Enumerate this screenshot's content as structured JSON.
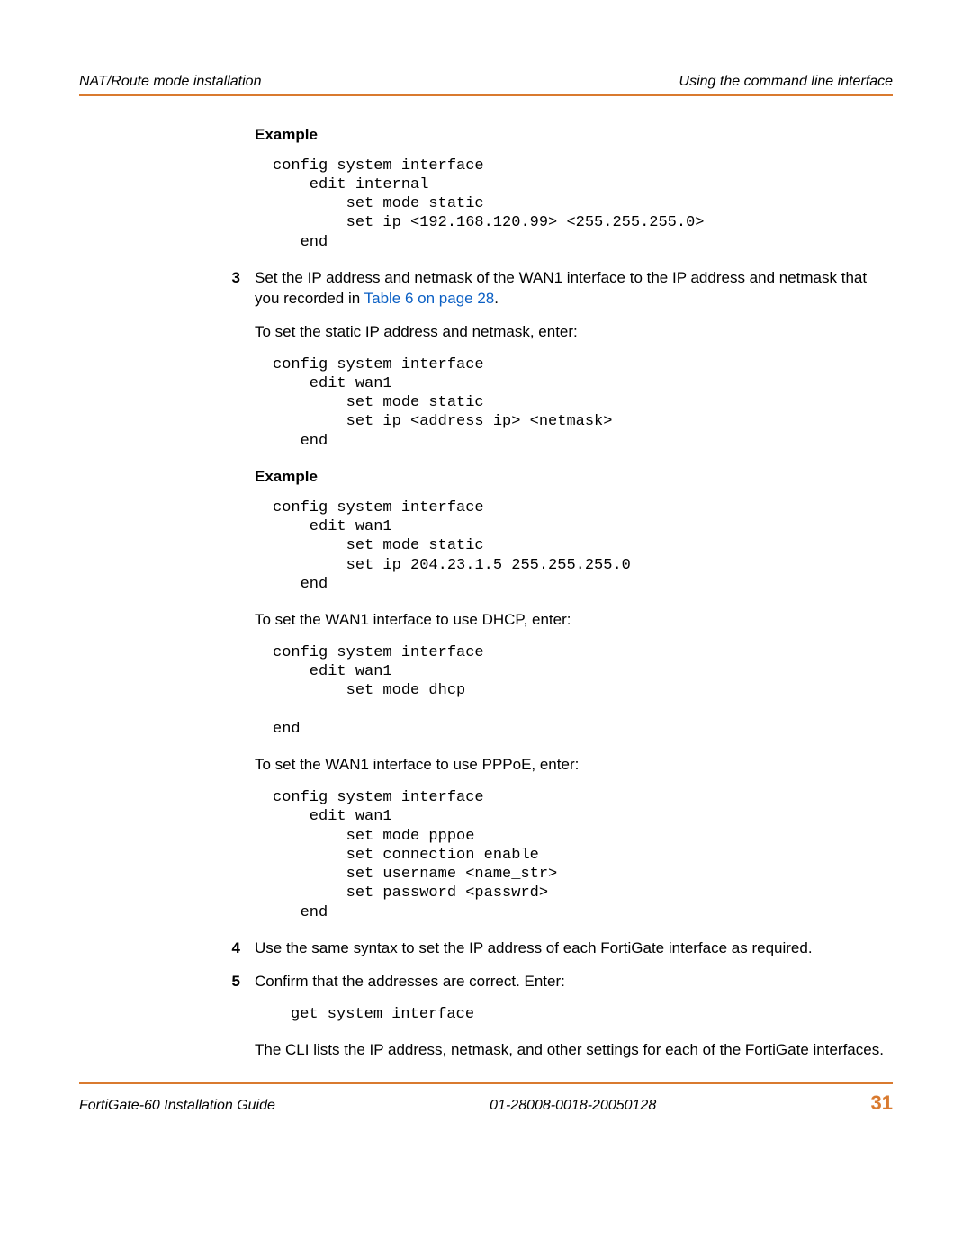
{
  "header": {
    "left": "NAT/Route mode installation",
    "right": "Using the command line interface"
  },
  "example1_heading": "Example",
  "code1": "config system interface\n    edit internal\n        set mode static\n        set ip <192.168.120.99> <255.255.255.0>\n   end",
  "step3_num": "3",
  "step3_text_a": "Set the IP address and netmask of the WAN1 interface to the IP address and netmask that you recorded in ",
  "step3_link": "Table 6 on page 28",
  "step3_text_b": ".",
  "para1": "To set the static IP address and netmask, enter:",
  "code2": "config system interface\n    edit wan1\n        set mode static\n        set ip <address_ip> <netmask>\n   end",
  "example2_heading": "Example",
  "code3": "config system interface\n    edit wan1\n        set mode static\n        set ip 204.23.1.5 255.255.255.0\n   end",
  "para2": "To set the WAN1 interface to use DHCP, enter:",
  "code4": "config system interface\n    edit wan1\n        set mode dhcp\n\nend",
  "para3": "To set the WAN1 interface to use PPPoE, enter:",
  "code5": "config system interface\n    edit wan1\n        set mode pppoe\n        set connection enable\n        set username <name_str>\n        set password <passwrd>\n   end",
  "step4_num": "4",
  "step4_text": "Use the same syntax to set the IP address of each FortiGate interface as required.",
  "step5_num": "5",
  "step5_text": "Confirm that the addresses are correct. Enter:",
  "code6": "get system interface",
  "para4": "The CLI lists the IP address, netmask, and other settings for each of the FortiGate interfaces.",
  "footer": {
    "left": "FortiGate-60 Installation Guide",
    "center": "01-28008-0018-20050128",
    "page": "31"
  }
}
